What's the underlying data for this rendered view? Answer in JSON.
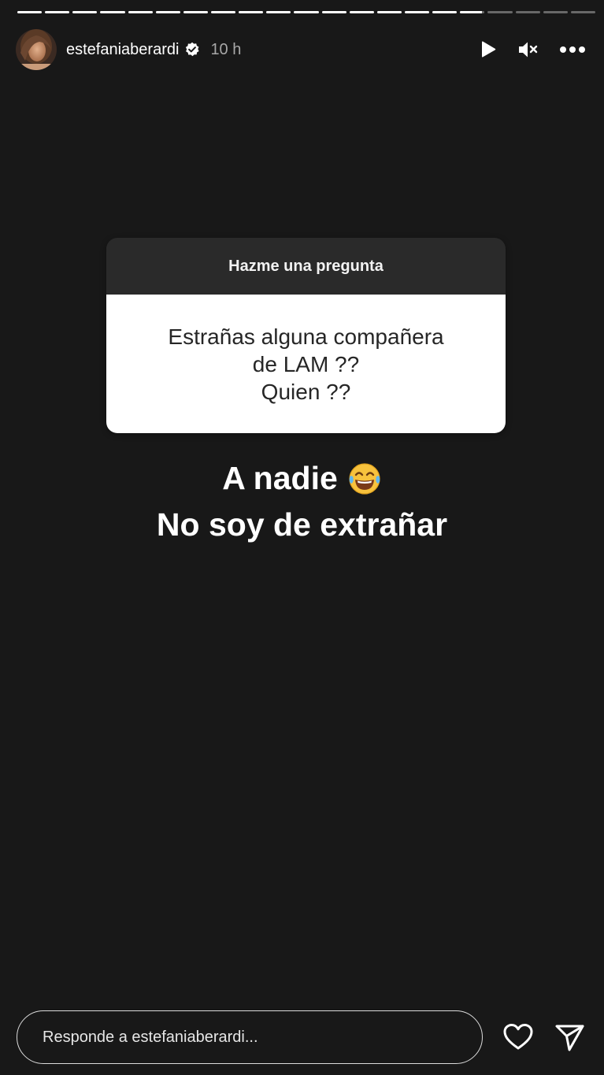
{
  "story": {
    "progress": {
      "segments_total": 21,
      "segments_completed": 16,
      "current_segment_fraction": 0.9
    },
    "header": {
      "username": "estefaniaberardi",
      "verified": true,
      "time_ago": "10 h",
      "icons": {
        "avatar": "profile-photo",
        "verified": "verified-badge-icon",
        "play": "play-icon",
        "mute": "muted-speaker-icon",
        "more": "more-options-icon"
      }
    },
    "question_sticker": {
      "title": "Hazme una pregunta",
      "question": "Estrañas alguna compañera\nde LAM ??\nQuien ??"
    },
    "answer": {
      "line1": "A nadie",
      "line2": "No soy de extrañar",
      "emoji": "face-with-tears-of-joy"
    },
    "footer": {
      "reply_placeholder": "Responde a estefaniaberardi...",
      "icons": {
        "like": "heart-icon",
        "share": "send-icon"
      }
    },
    "colors": {
      "background": "#181818",
      "card_header": "#2a2a2a",
      "card_body": "#ffffff",
      "text_primary": "#ffffff",
      "text_secondary": "#a8a8a8"
    }
  }
}
